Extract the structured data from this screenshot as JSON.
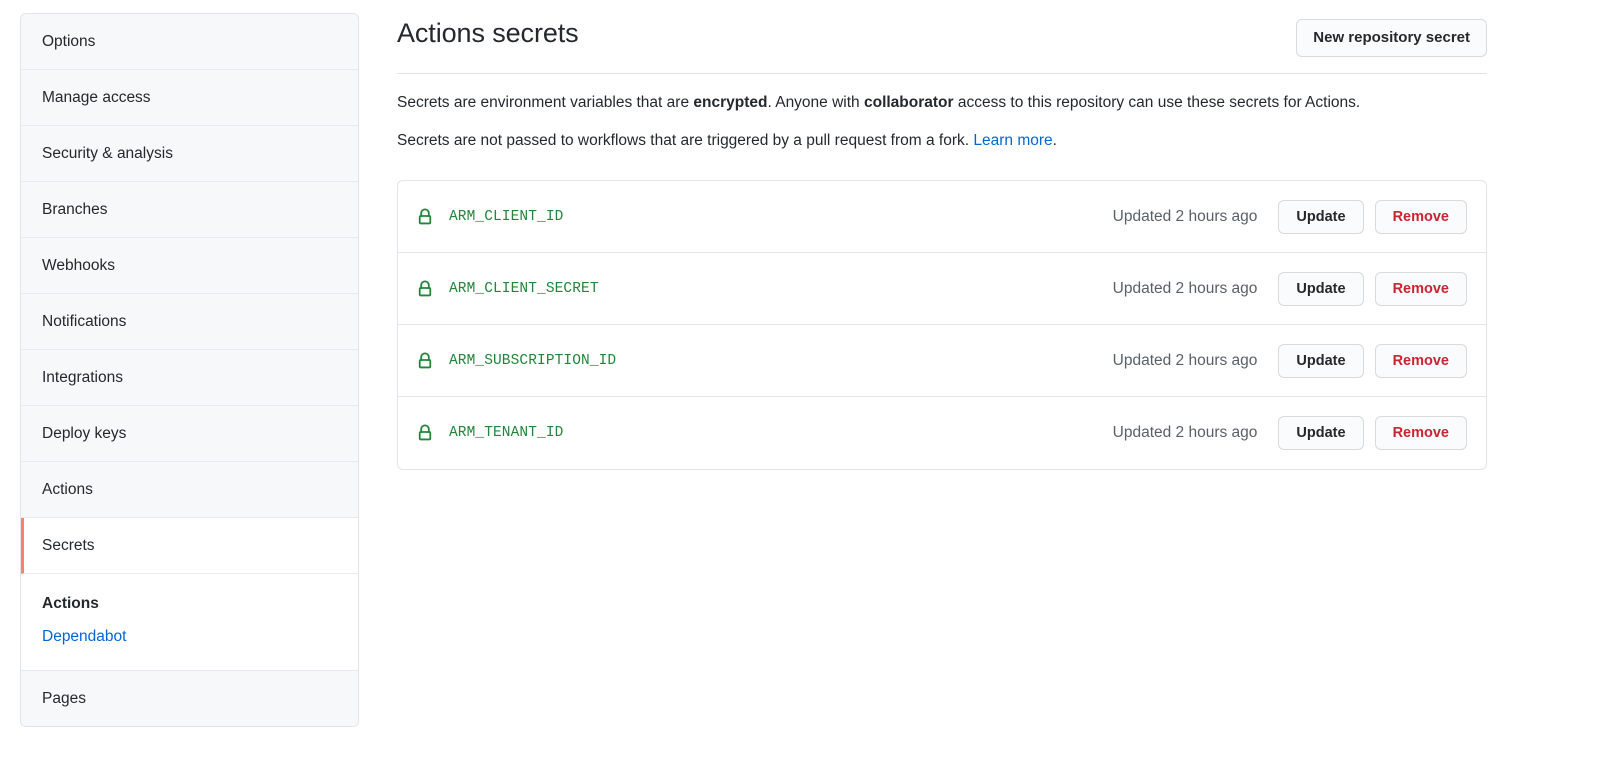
{
  "sidebar": {
    "items": [
      {
        "label": "Options",
        "selected": false
      },
      {
        "label": "Manage access",
        "selected": false
      },
      {
        "label": "Security & analysis",
        "selected": false
      },
      {
        "label": "Branches",
        "selected": false
      },
      {
        "label": "Webhooks",
        "selected": false
      },
      {
        "label": "Notifications",
        "selected": false
      },
      {
        "label": "Integrations",
        "selected": false
      },
      {
        "label": "Deploy keys",
        "selected": false
      },
      {
        "label": "Actions",
        "selected": false
      },
      {
        "label": "Secrets",
        "selected": true
      },
      {
        "label": "Pages",
        "selected": false
      }
    ],
    "subnav": {
      "current_label": "Actions",
      "link_label": "Dependabot"
    },
    "accent_color": "#f9826c",
    "link_color": "#0366d6"
  },
  "header": {
    "title": "Actions secrets",
    "new_secret_button": "New repository secret"
  },
  "description": {
    "line1_part1": "Secrets are environment variables that are ",
    "line1_bold1": "encrypted",
    "line1_part2": ". Anyone with ",
    "line1_bold2": "collaborator",
    "line1_part3": " access to this repository can use these secrets for Actions.",
    "line2_part1": "Secrets are not passed to workflows that are triggered by a pull request from a fork. ",
    "line2_link": "Learn more",
    "line2_part2": "."
  },
  "secrets": {
    "icon_name": "lock-icon",
    "icon_color": "#22863a",
    "update_label": "Update",
    "remove_label": "Remove",
    "remove_color": "#cb2431",
    "rows": [
      {
        "name": "ARM_CLIENT_ID",
        "updated": "Updated 2 hours ago"
      },
      {
        "name": "ARM_CLIENT_SECRET",
        "updated": "Updated 2 hours ago"
      },
      {
        "name": "ARM_SUBSCRIPTION_ID",
        "updated": "Updated 2 hours ago"
      },
      {
        "name": "ARM_TENANT_ID",
        "updated": "Updated 2 hours ago"
      }
    ]
  }
}
